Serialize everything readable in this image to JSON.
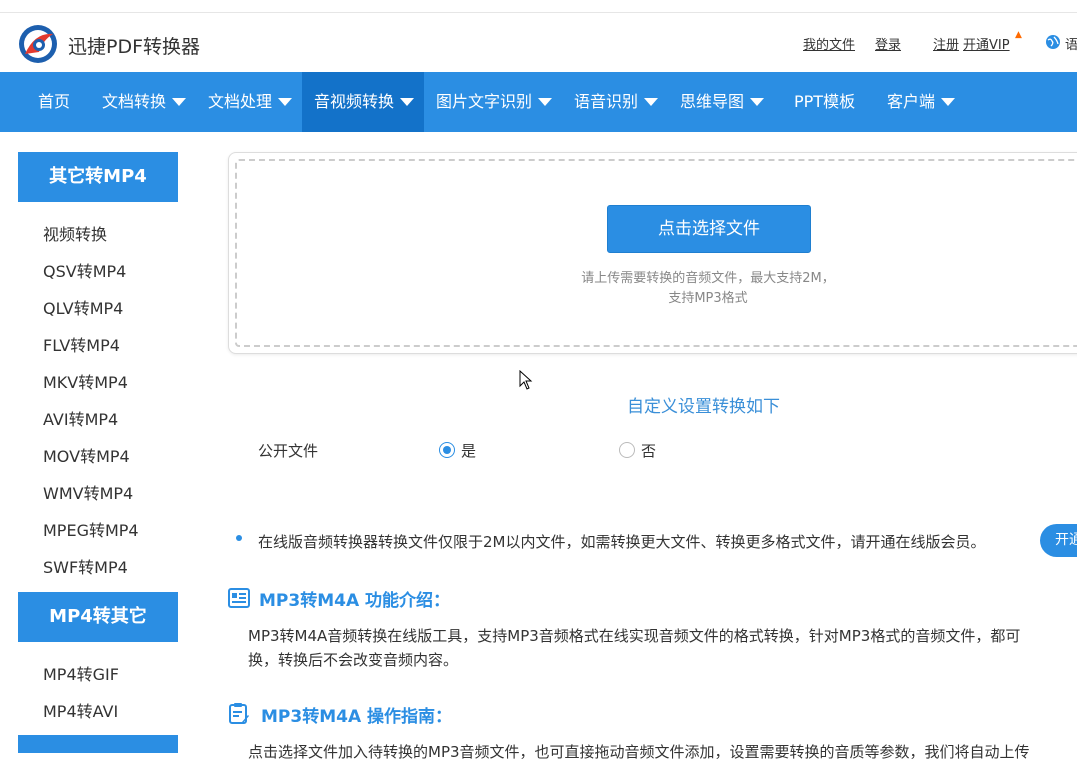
{
  "header": {
    "brand": "迅捷PDF转换器",
    "links": {
      "my_files": "我的文件",
      "login": "登录",
      "register": "注册",
      "vip": "开通VIP",
      "lang": "语"
    }
  },
  "nav": {
    "home": "首页",
    "doc_convert": "文档转换",
    "doc_process": "文档处理",
    "av_convert": "音视频转换",
    "ocr": "图片文字识别",
    "speech": "语音识别",
    "mindmap": "思维导图",
    "ppt": "PPT模板",
    "client": "客户端"
  },
  "sidebar": {
    "group1_title": "其它转MP4",
    "group1_items": [
      "视频转换",
      "QSV转MP4",
      "QLV转MP4",
      "FLV转MP4",
      "MKV转MP4",
      "AVI转MP4",
      "MOV转MP4",
      "WMV转MP4",
      "MPEG转MP4",
      "SWF转MP4"
    ],
    "group2_title": "MP4转其它",
    "group2_items": [
      "MP4转GIF",
      "MP4转AVI"
    ]
  },
  "upload": {
    "button": "点击选择文件",
    "hint_line1": "请上传需要转换的音频文件，最大支持2M，",
    "hint_line2": "支持MP3格式"
  },
  "settings": {
    "title": "自定义设置转换如下",
    "public_label": "公开文件",
    "yes": "是",
    "no": "否",
    "selected": "是"
  },
  "notice": {
    "text": "在线版音频转换器转换文件仅限于2M以内文件，如需转换更大文件、转换更多格式文件，请开通在线版会员。",
    "button": "开通"
  },
  "sections": {
    "intro_title": "MP3转M4A 功能介绍：",
    "intro_line1": "MP3转M4A音频转换在线版工具，支持MP3音频格式在线实现音频文件的格式转换，针对MP3格式的音频文件，都可",
    "intro_line2": "换，转换后不会改变音频内容。",
    "guide_title": "MP3转M4A 操作指南：",
    "guide_line1": "点击选择文件加入待转换的MP3音频文件，也可直接拖动音频文件添加，设置需要转换的音质等参数，我们将自动上传"
  },
  "colors": {
    "primary": "#2b8ee3",
    "nav_active": "#1372c9"
  },
  "icons": [
    "logo-icon",
    "fire-icon",
    "globe-icon",
    "caret-down-icon",
    "doc-list-icon",
    "clipboard-edit-icon",
    "cursor-icon"
  ]
}
